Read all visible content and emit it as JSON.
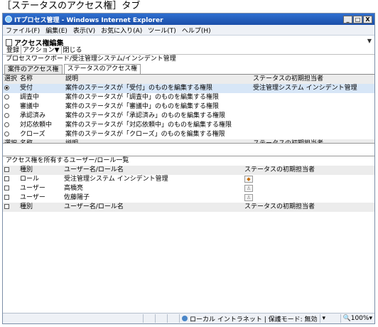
{
  "caption": "［ステータスのアクセス権］タブ",
  "window": {
    "title": "ITプロセス管理 - Windows Internet Explorer",
    "buttons": [
      "_",
      "□",
      "X"
    ]
  },
  "menu": [
    "ファイル(F)",
    "編集(E)",
    "表示(V)",
    "お気に入り(A)",
    "ツール(T)",
    "ヘルプ(H)"
  ],
  "app": {
    "title": "アクセス権編集",
    "toolbar": {
      "register": "登録",
      "action": "アクション▼",
      "close": "閉じる"
    },
    "breadcrumb": "プロセスワークボード/受注管理システム/インシデント管理",
    "tabs": [
      "案件のアクセス権",
      "ステータスのアクセス権"
    ]
  },
  "status_table": {
    "headers": {
      "select": "選択",
      "name": "名称",
      "desc": "説明",
      "initial": "ステータスの初期担当者"
    },
    "rows": [
      {
        "name": "受付",
        "desc": "案件のステータスが「受付」のものを編集する権限",
        "initial": "受注管理システム インシデント管理",
        "selected": true
      },
      {
        "name": "調査中",
        "desc": "案件のステータスが「調査中」のものを編集する権限",
        "initial": "",
        "selected": false
      },
      {
        "name": "審議中",
        "desc": "案件のステータスが「審議中」のものを編集する権限",
        "initial": "",
        "selected": false
      },
      {
        "name": "承認済み",
        "desc": "案件のステータスが「承認済み」のものを編集する権限",
        "initial": "",
        "selected": false
      },
      {
        "name": "対応依頼中",
        "desc": "案件のステータスが「対応依頼中」のものを編集する権限",
        "initial": "",
        "selected": false
      },
      {
        "name": "クローズ",
        "desc": "案件のステータスが「クローズ」のものを編集する権限",
        "initial": "",
        "selected": false
      }
    ]
  },
  "user_list": {
    "title": "アクセス権を所有するユーザー/ロール一覧",
    "headers": {
      "type": "種別",
      "name": "ユーザー名/ロール名",
      "initial": "ステータスの初期担当者"
    },
    "rows": [
      {
        "type": "ロール",
        "name": "受注管理システム インシデント管理",
        "initial_icon": "role-assign-icon"
      },
      {
        "type": "ユーザー",
        "name": "高橋亮",
        "initial_icon": "user-assign-icon"
      },
      {
        "type": "ユーザー",
        "name": "佐藤陽子",
        "initial_icon": "user-assign-icon"
      }
    ]
  },
  "statusbar": {
    "zone": "ローカル イントラネット | 保護モード: 無効",
    "zoom": "100%"
  }
}
